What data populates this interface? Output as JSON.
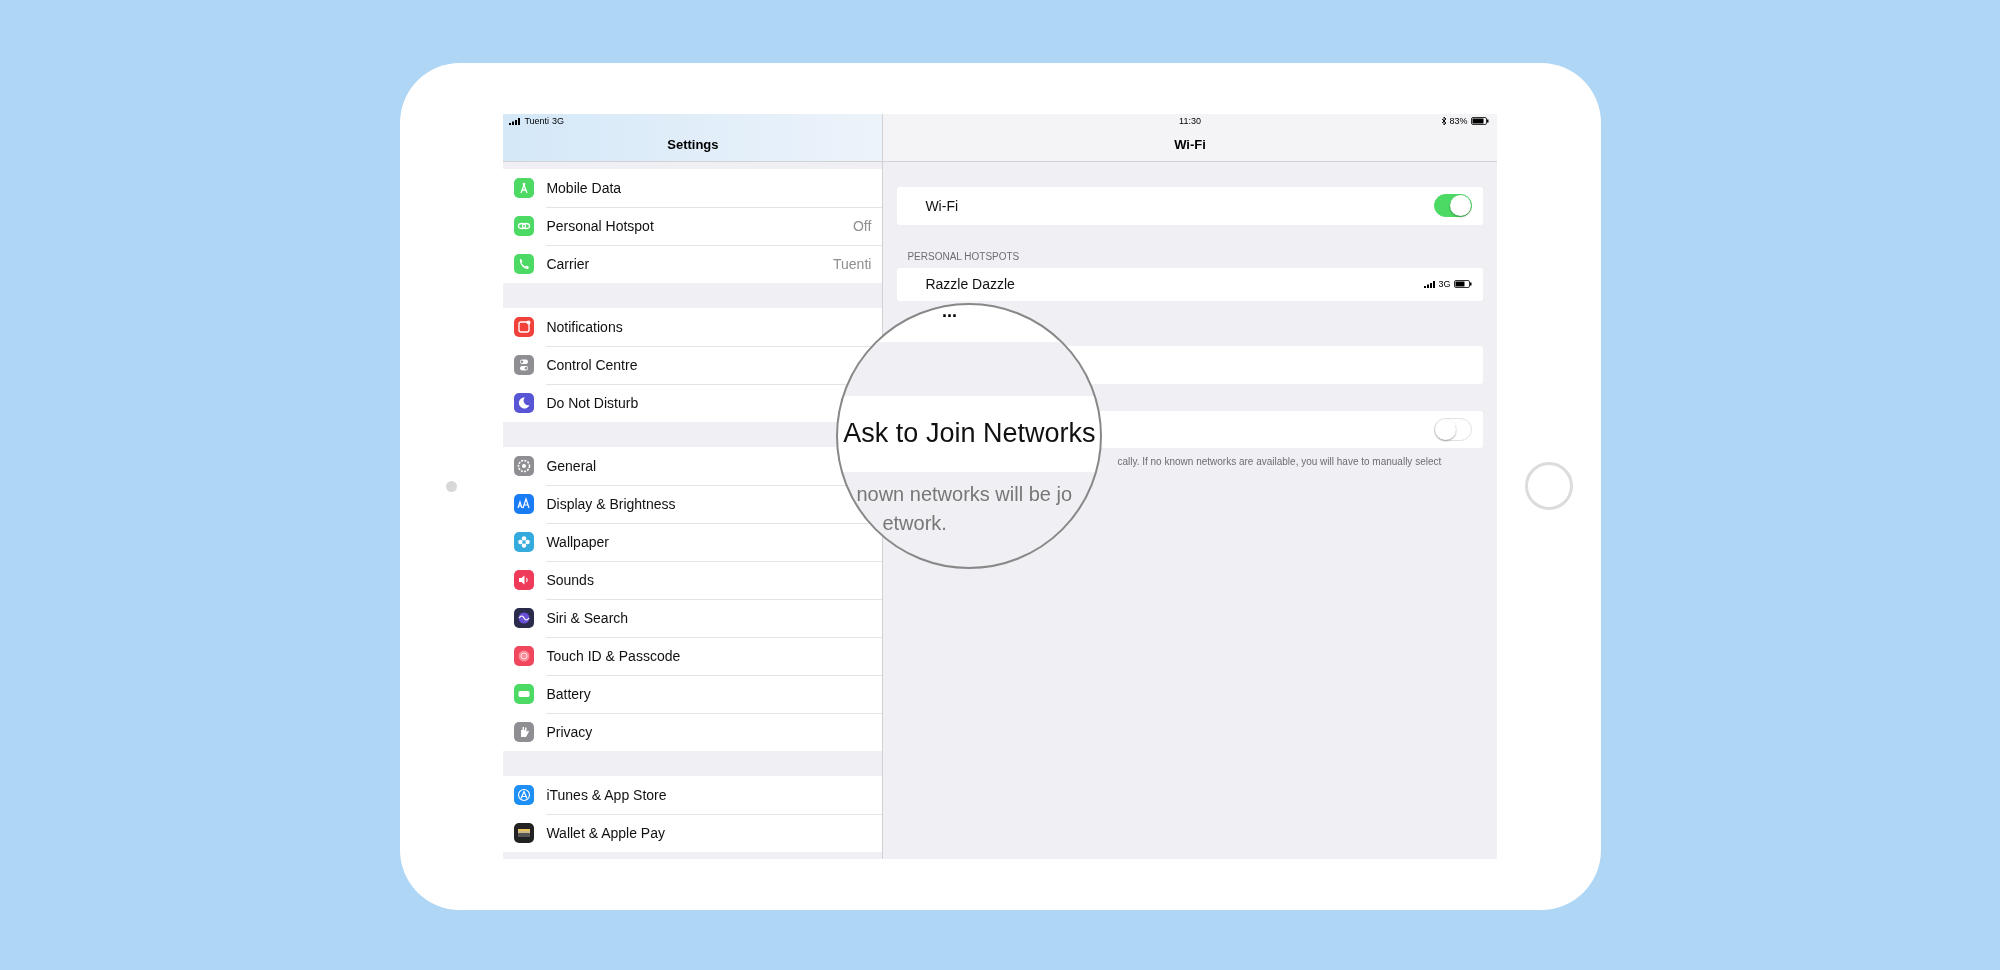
{
  "status_bar": {
    "carrier": "Tuenti",
    "network": "3G",
    "time": "11:30",
    "battery": "83%"
  },
  "sidebar": {
    "title": "Settings",
    "groups": [
      [
        {
          "label": "Mobile Data",
          "kind": "antenna",
          "color": "#4cd964"
        },
        {
          "label": "Personal Hotspot",
          "kind": "link",
          "color": "#4cd964",
          "value": "Off"
        },
        {
          "label": "Carrier",
          "kind": "phone",
          "color": "#4cd964",
          "value": "Tuenti"
        }
      ],
      [
        {
          "label": "Notifications",
          "kind": "notification",
          "color": "#f0423a"
        },
        {
          "label": "Control Centre",
          "kind": "switches",
          "color": "#8e8e93"
        },
        {
          "label": "Do Not Disturb",
          "kind": "moon",
          "color": "#5856d6"
        }
      ],
      [
        {
          "label": "General",
          "kind": "gear",
          "color": "#8e8e93"
        },
        {
          "label": "Display & Brightness",
          "kind": "textsize",
          "color": "#1a7cf5"
        },
        {
          "label": "Wallpaper",
          "kind": "flower",
          "color": "#35aadc"
        },
        {
          "label": "Sounds",
          "kind": "speaker",
          "color": "#f03a5a"
        },
        {
          "label": "Siri & Search",
          "kind": "orb",
          "color": "#2a2a4a"
        },
        {
          "label": "Touch ID & Passcode",
          "kind": "fingerprint",
          "color": "#f0475e"
        },
        {
          "label": "Battery",
          "kind": "battery",
          "color": "#4cd964"
        },
        {
          "label": "Privacy",
          "kind": "hand",
          "color": "#8e8e93"
        }
      ],
      [
        {
          "label": "iTunes & App Store",
          "kind": "appstore",
          "color": "#1d8ff5"
        },
        {
          "label": "Wallet & Apple Pay",
          "kind": "wallet",
          "color": "#222222"
        }
      ]
    ]
  },
  "wifi": {
    "title": "Wi-Fi",
    "wifi_row": {
      "label": "Wi-Fi",
      "on": true
    },
    "hotspots_header": "PERSONAL HOTSPOTS",
    "hotspots": [
      {
        "name": "Razzle Dazzle",
        "network": "3G"
      }
    ],
    "ask_to_join": {
      "on": false
    },
    "footer_tail": "cally. If no known networks are available, you will have to manually select"
  },
  "magnifier": {
    "top_text": "...",
    "title": "Ask to Join Networks",
    "footer_lines": [
      "nown networks will be jo",
      "etwork."
    ]
  }
}
